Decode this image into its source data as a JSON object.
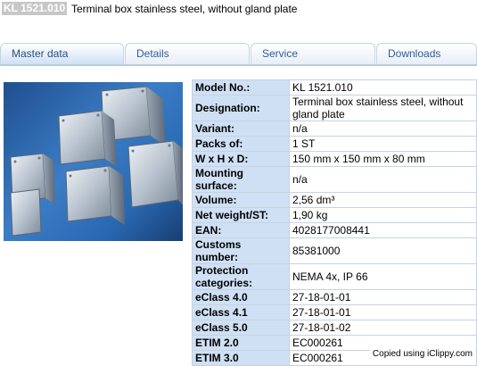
{
  "header": {
    "model_badge": "KL 1521.010",
    "title": "Terminal box stainless steel, without gland plate"
  },
  "tabs": [
    {
      "label": "Master data"
    },
    {
      "label": "Details"
    },
    {
      "label": "Service"
    },
    {
      "label": "Downloads"
    }
  ],
  "specs": [
    {
      "label": "Model No.:",
      "value": "KL 1521.010"
    },
    {
      "label": "Designation:",
      "value": "Terminal box stainless steel, without gland plate"
    },
    {
      "label": "Variant:",
      "value": "n/a"
    },
    {
      "label": "Packs of:",
      "value": "1 ST"
    },
    {
      "label": "W x H x D:",
      "value": "150 mm x 150 mm x 80 mm"
    },
    {
      "label": "Mounting surface:",
      "value": "n/a"
    },
    {
      "label": "Volume:",
      "value": "2,56 dm³"
    },
    {
      "label": "Net weight/ST:",
      "value": "1,90 kg"
    },
    {
      "label": "EAN:",
      "value": "4028177008441"
    },
    {
      "label": "Customs number:",
      "value": "85381000"
    },
    {
      "label": "Protection categories:",
      "value": "NEMA 4x, IP 66"
    },
    {
      "label": "eClass 4.0",
      "value": "27-18-01-01"
    },
    {
      "label": "eClass 4.1",
      "value": "27-18-01-01"
    },
    {
      "label": "eClass 5.0",
      "value": "27-18-01-02"
    },
    {
      "label": "ETIM 2.0",
      "value": "EC000261"
    },
    {
      "label": "ETIM 3.0",
      "value": "EC000261"
    }
  ],
  "footer": {
    "note": "Copied using iClippy.com"
  }
}
